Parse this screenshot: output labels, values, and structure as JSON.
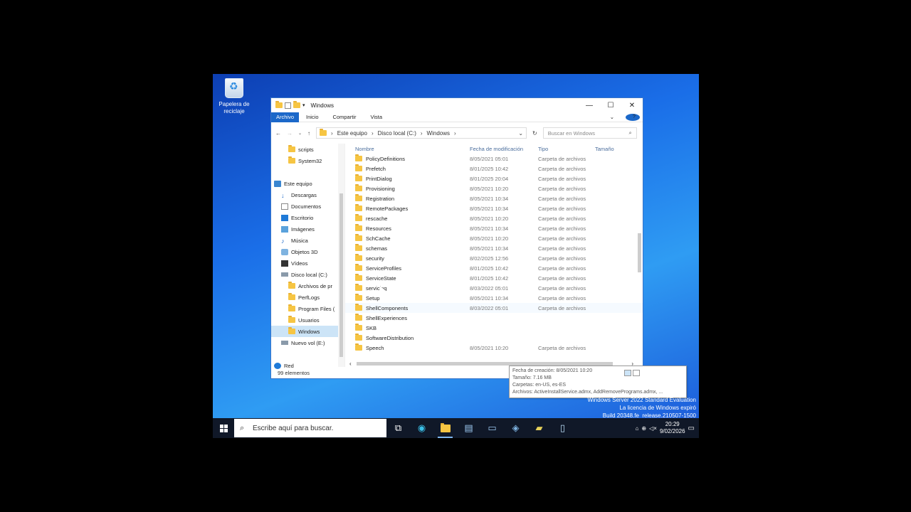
{
  "desktop": {
    "recycle_bin_label": "Papelera de reciclaje",
    "watermark": [
      "Windows Server 2022 Standard Evaluation",
      "La licencia de Windows expiró",
      "Build 20348.fe_release.210507-1500"
    ]
  },
  "explorer": {
    "title": "Windows",
    "ribbon_tabs": [
      "Archivo",
      "Inicio",
      "Compartir",
      "Vista"
    ],
    "address_path": [
      "Este equipo",
      "Disco local (C:)",
      "Windows"
    ],
    "search_placeholder": "Buscar en Windows",
    "nav_items": [
      {
        "label": "scripts",
        "icon": "folder-icon",
        "indent": 2
      },
      {
        "label": "System32",
        "icon": "folder-icon",
        "indent": 2
      },
      {
        "label": "",
        "icon": "",
        "indent": 0
      },
      {
        "label": "Este equipo",
        "icon": "computer-icon",
        "indent": 0
      },
      {
        "label": "Descargas",
        "icon": "download-icon",
        "indent": 1
      },
      {
        "label": "Documentos",
        "icon": "document-icon",
        "indent": 1
      },
      {
        "label": "Escritorio",
        "icon": "desktop-icon",
        "indent": 1
      },
      {
        "label": "Imágenes",
        "icon": "pictures-icon",
        "indent": 1
      },
      {
        "label": "Música",
        "icon": "music-icon",
        "indent": 1
      },
      {
        "label": "Objetos 3D",
        "icon": "objects-3d-icon",
        "indent": 1
      },
      {
        "label": "Vídeos",
        "icon": "video-icon",
        "indent": 1
      },
      {
        "label": "Disco local (C:)",
        "icon": "drive-icon",
        "indent": 1
      },
      {
        "label": "Archivos de pr",
        "icon": "folder-icon",
        "indent": 2
      },
      {
        "label": "PerfLogs",
        "icon": "folder-icon",
        "indent": 2
      },
      {
        "label": "Program Files (",
        "icon": "folder-icon",
        "indent": 2
      },
      {
        "label": "Usuarios",
        "icon": "folder-icon",
        "indent": 2
      },
      {
        "label": "Windows",
        "icon": "folder-icon",
        "indent": 2,
        "selected": true
      },
      {
        "label": "Nuevo vol (E:)",
        "icon": "drive-icon",
        "indent": 1
      },
      {
        "label": "",
        "icon": "",
        "indent": 0
      },
      {
        "label": "Red",
        "icon": "network-icon",
        "indent": 0
      }
    ],
    "columns": [
      "Nombre",
      "Fecha de modificación",
      "Tipo",
      "Tamaño"
    ],
    "files": [
      {
        "name": "PolicyDefinitions",
        "date": "8/05/2021 05:01",
        "type": "Carpeta de archivos"
      },
      {
        "name": "Prefetch",
        "date": "8/01/2025 10:42",
        "type": "Carpeta de archivos"
      },
      {
        "name": "PrintDialog",
        "date": "8/01/2025 20:04",
        "type": "Carpeta de archivos"
      },
      {
        "name": "Provisioning",
        "date": "8/05/2021 10:20",
        "type": "Carpeta de archivos"
      },
      {
        "name": "Registration",
        "date": "8/05/2021 10:34",
        "type": "Carpeta de archivos"
      },
      {
        "name": "RemotePackages",
        "date": "8/05/2021 10:34",
        "type": "Carpeta de archivos"
      },
      {
        "name": "rescache",
        "date": "8/05/2021 10:20",
        "type": "Carpeta de archivos"
      },
      {
        "name": "Resources",
        "date": "8/05/2021 10:34",
        "type": "Carpeta de archivos"
      },
      {
        "name": "SchCache",
        "date": "8/05/2021 10:20",
        "type": "Carpeta de archivos"
      },
      {
        "name": "schemas",
        "date": "8/05/2021 10:34",
        "type": "Carpeta de archivos"
      },
      {
        "name": "security",
        "date": "8/02/2025 12:56",
        "type": "Carpeta de archivos"
      },
      {
        "name": "ServiceProfiles",
        "date": "8/01/2025 10:42",
        "type": "Carpeta de archivos"
      },
      {
        "name": "ServiceState",
        "date": "8/01/2025 10:42",
        "type": "Carpeta de archivos"
      },
      {
        "name": "servicing",
        "date": "8/03/2022 05:01",
        "type": "Carpeta de archivos"
      },
      {
        "name": "Setup",
        "date": "8/05/2021 10:34",
        "type": "Carpeta de archivos"
      },
      {
        "name": "ShellComponents",
        "date": "8/03/2022 05:01",
        "type": "Carpeta de archivos",
        "hover": true
      },
      {
        "name": "ShellExperiences",
        "date": "",
        "type": ""
      },
      {
        "name": "SKB",
        "date": "",
        "type": ""
      },
      {
        "name": "SoftwareDistribution",
        "date": "",
        "type": ""
      },
      {
        "name": "Speech",
        "date": "8/05/2021 10:20",
        "type": "Carpeta de archivos"
      }
    ],
    "tooltip": [
      "Fecha de creación: 8/05/2021 10:20",
      "Tamaño: 7.16 MB",
      "Carpetas: en-US, es-ES",
      "Archivos: ActiveInstallService.admx, AddRemovePrograms.admx, ..."
    ],
    "status_text": "99 elementos"
  },
  "taskbar": {
    "search_placeholder": "Escribe aquí para buscar.",
    "time": "20:29",
    "date": "9/02/2026"
  }
}
